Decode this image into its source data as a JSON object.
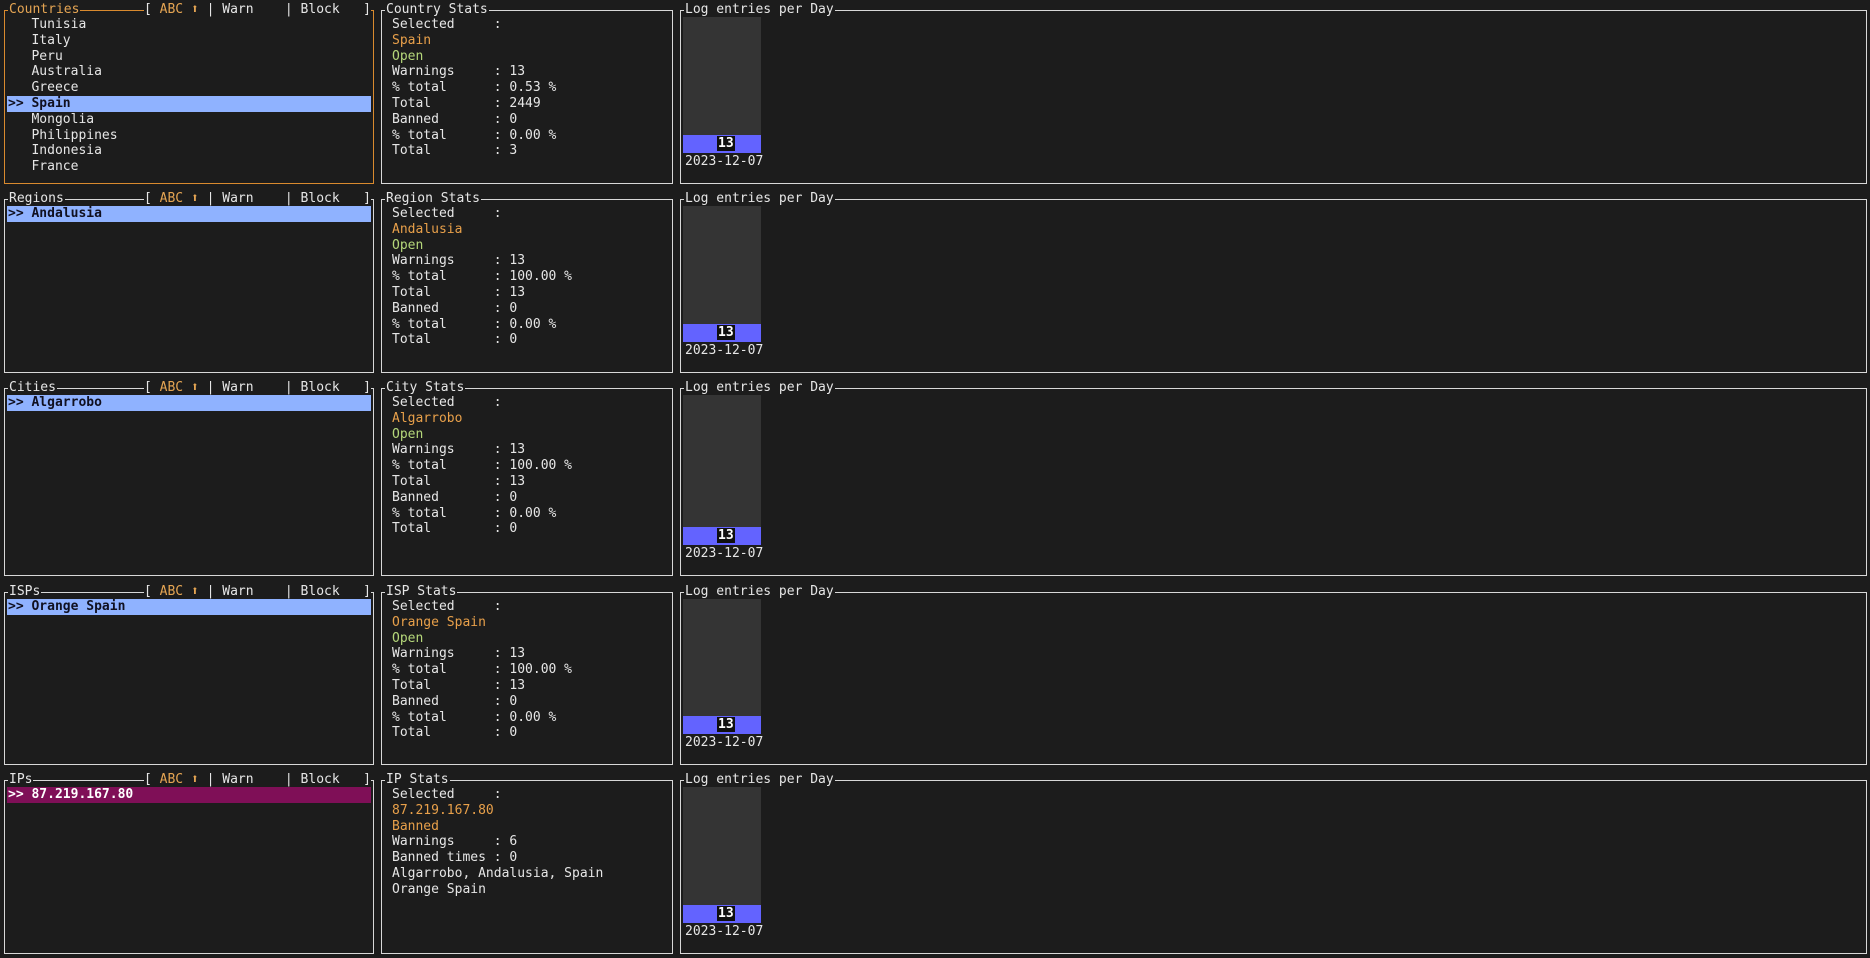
{
  "sort_header": {
    "open": "[",
    "abc": " ABC ⬆",
    "warn": " | Warn   ",
    "block": " | Block   ",
    "close": "]"
  },
  "chart_title": "Log entries per Day",
  "panels": [
    {
      "list_title": "Countries",
      "stats_title": "Country Stats",
      "items": [
        "Tunisia",
        "Italy",
        "Peru",
        "Australia",
        "Greece",
        "Spain",
        "Mongolia",
        "Philippines",
        "Indonesia",
        "France"
      ],
      "selected_index": 5,
      "stats": [
        {
          "text": "Selected     :",
          "color": ""
        },
        {
          "text": "Spain",
          "color": "orange"
        },
        {
          "text": "Open",
          "color": "green"
        },
        {
          "text": "Warnings     : 13",
          "color": ""
        },
        {
          "text": "% total      : 0.53 %",
          "color": ""
        },
        {
          "text": "Total        : 2449",
          "color": ""
        },
        {
          "text": "Banned       : 0",
          "color": ""
        },
        {
          "text": "% total      : 0.00 %",
          "color": ""
        },
        {
          "text": "Total        : 3",
          "color": ""
        }
      ],
      "chart": {
        "bar_value": "13",
        "date": "2023-12-07"
      }
    },
    {
      "list_title": "Regions",
      "stats_title": "Region Stats",
      "items": [
        "Andalusia"
      ],
      "selected_index": 0,
      "stats": [
        {
          "text": "Selected     :",
          "color": ""
        },
        {
          "text": "Andalusia",
          "color": "orange"
        },
        {
          "text": "Open",
          "color": "green"
        },
        {
          "text": "Warnings     : 13",
          "color": ""
        },
        {
          "text": "% total      : 100.00 %",
          "color": ""
        },
        {
          "text": "Total        : 13",
          "color": ""
        },
        {
          "text": "Banned       : 0",
          "color": ""
        },
        {
          "text": "% total      : 0.00 %",
          "color": ""
        },
        {
          "text": "Total        : 0",
          "color": ""
        }
      ],
      "chart": {
        "bar_value": "13",
        "date": "2023-12-07"
      }
    },
    {
      "list_title": "Cities",
      "stats_title": "City Stats",
      "items": [
        "Algarrobo"
      ],
      "selected_index": 0,
      "stats": [
        {
          "text": "Selected     :",
          "color": ""
        },
        {
          "text": "Algarrobo",
          "color": "orange"
        },
        {
          "text": "Open",
          "color": "green"
        },
        {
          "text": "Warnings     : 13",
          "color": ""
        },
        {
          "text": "% total      : 100.00 %",
          "color": ""
        },
        {
          "text": "Total        : 13",
          "color": ""
        },
        {
          "text": "Banned       : 0",
          "color": ""
        },
        {
          "text": "% total      : 0.00 %",
          "color": ""
        },
        {
          "text": "Total        : 0",
          "color": ""
        }
      ],
      "chart": {
        "bar_value": "13",
        "date": "2023-12-07"
      }
    },
    {
      "list_title": "ISPs",
      "stats_title": "ISP Stats",
      "items": [
        "Orange Spain"
      ],
      "selected_index": 0,
      "stats": [
        {
          "text": "Selected     :",
          "color": ""
        },
        {
          "text": "Orange Spain",
          "color": "orange"
        },
        {
          "text": "Open",
          "color": "green"
        },
        {
          "text": "Warnings     : 13",
          "color": ""
        },
        {
          "text": "% total      : 100.00 %",
          "color": ""
        },
        {
          "text": "Total        : 13",
          "color": ""
        },
        {
          "text": "Banned       : 0",
          "color": ""
        },
        {
          "text": "% total      : 0.00 %",
          "color": ""
        },
        {
          "text": "Total        : 0",
          "color": ""
        }
      ],
      "chart": {
        "bar_value": "13",
        "date": "2023-12-07"
      }
    },
    {
      "list_title": "IPs",
      "stats_title": "IP Stats",
      "items": [
        "87.219.167.80"
      ],
      "selected_index": 0,
      "selected_banned": true,
      "stats": [
        {
          "text": "Selected     :",
          "color": ""
        },
        {
          "text": "87.219.167.80",
          "color": "orange"
        },
        {
          "text": "Banned",
          "color": "orange"
        },
        {
          "text": "Warnings     : 6",
          "color": ""
        },
        {
          "text": "Banned times : 0",
          "color": ""
        },
        {
          "text": "Algarrobo, Andalusia, Spain",
          "color": ""
        },
        {
          "text": "Orange Spain",
          "color": ""
        }
      ],
      "chart": {
        "bar_value": "13",
        "date": "2023-12-07"
      }
    }
  ],
  "colors": {
    "active_border": "#d98a2e",
    "selected_row": "#8fb2ff",
    "banned_row": "#7f0f57",
    "bar": "#6363ff",
    "orange_text": "#e8a04a",
    "green_text": "#b5d77a"
  }
}
